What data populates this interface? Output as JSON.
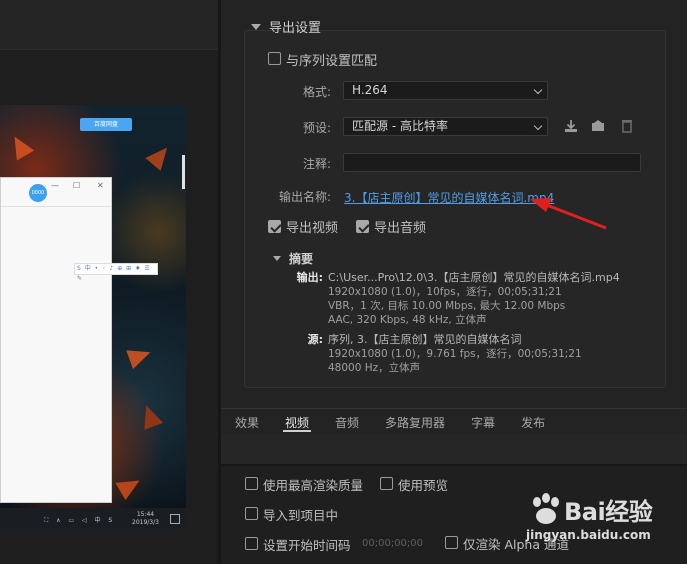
{
  "preview": {
    "baidu_button": "百度网盘",
    "win_circle_text": "0000",
    "ime_bar": "S 中 • ◦ ♪ ⊕ ⊞ ♦ ☰ ✎",
    "taskbar_icons": "⛶ ∧ ▭ ◁ 中 S",
    "taskbar_time": "15:44",
    "taskbar_date": "2019/3/3"
  },
  "export": {
    "section_title": "导出设置",
    "match_sequence": "与序列设置匹配",
    "format_label": "格式:",
    "format_value": "H.264",
    "preset_label": "预设:",
    "preset_value": "匹配源 - 高比特率",
    "comment_label": "注释:",
    "comment_value": "",
    "output_name_label": "输出名称:",
    "output_name_value": "3.【店主原创】常见的自媒体名词.mp4",
    "export_video": "导出视频",
    "export_audio": "导出音频",
    "export_video_checked": true,
    "export_audio_checked": true,
    "summary_title": "摘要",
    "output_key": "输出:",
    "output_lines": [
      "C:\\User...Pro\\12.0\\3.【店主原创】常见的自媒体名词.mp4",
      "1920x1080 (1.0)，10fps，逐行，00;05;31;21",
      "VBR，1 次, 目标 10.00 Mbps, 最大 12.00 Mbps",
      "AAC, 320 Kbps, 48  kHz, 立体声"
    ],
    "source_key": "源:",
    "source_lines": [
      "序列, 3.【店主原创】常见的自媒体名词",
      "1920x1080 (1.0)，9.761 fps，逐行，00;05;31;21",
      "48000 Hz，立体声"
    ]
  },
  "tabs": [
    {
      "label": "效果",
      "active": false
    },
    {
      "label": "视频",
      "active": true
    },
    {
      "label": "音频",
      "active": false
    },
    {
      "label": "多路复用器",
      "active": false
    },
    {
      "label": "字幕",
      "active": false
    },
    {
      "label": "发布",
      "active": false
    }
  ],
  "bottom": {
    "max_render_quality": "使用最高渲染质量",
    "use_preview": "使用预览",
    "import_to_project": "导入到项目中",
    "set_start_timecode": "设置开始时间码",
    "start_timecode_value": "00;00;00;00",
    "render_alpha_only": "仅渲染 Alpha 通道"
  },
  "watermark": {
    "brand": "Bai经验",
    "domain": "jingyan.baidu.com"
  },
  "colors": {
    "link": "#4f9de8",
    "arrow": "#e02020",
    "panel_bg": "#232323"
  }
}
